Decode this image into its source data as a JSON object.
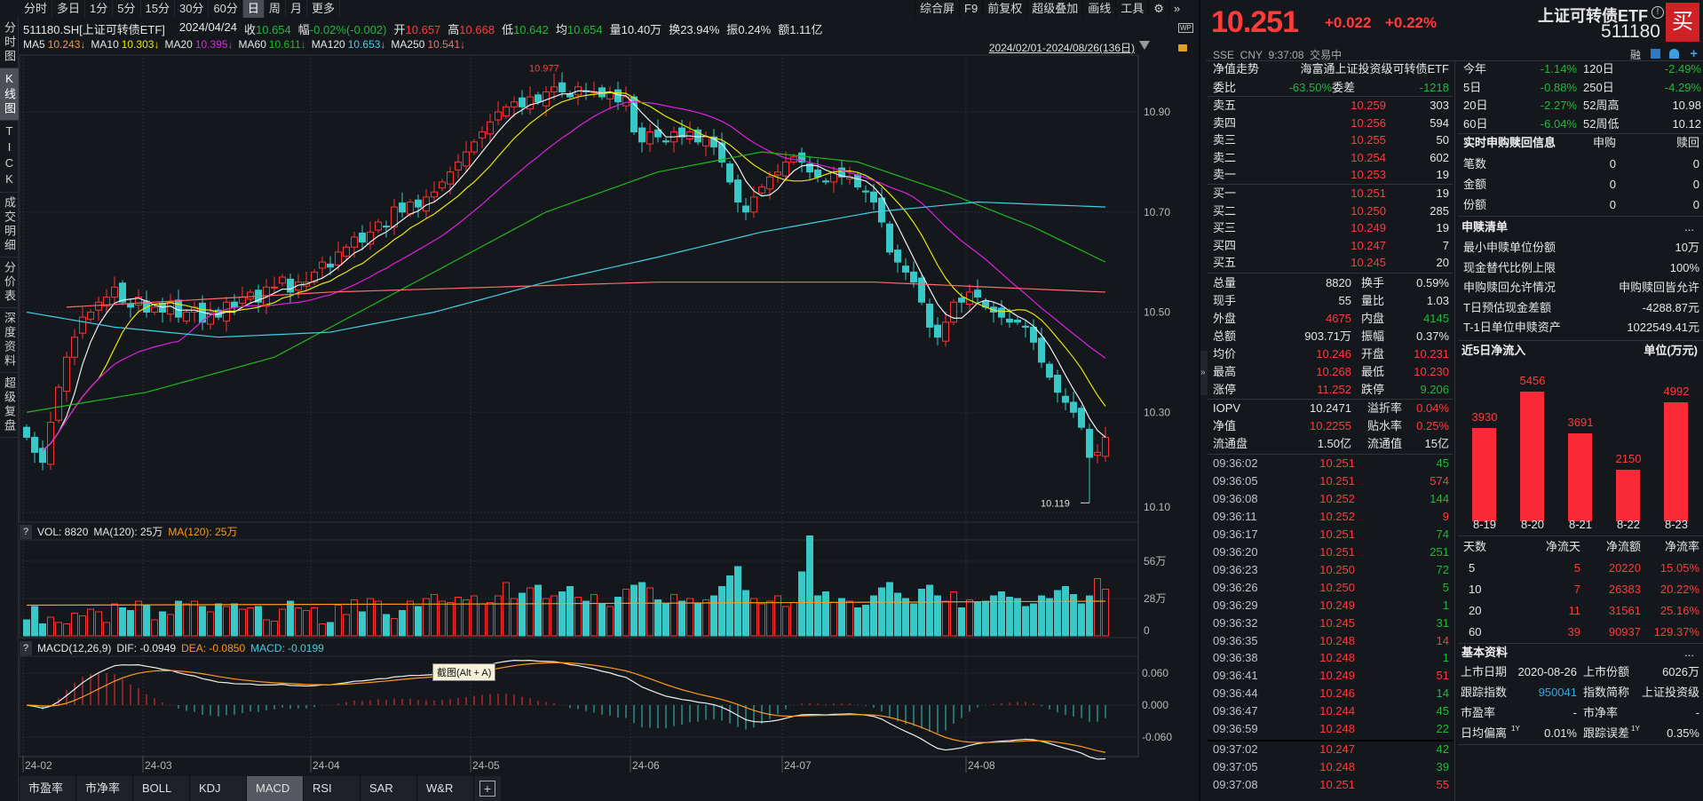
{
  "toolbar": {
    "periods": [
      "分时",
      "多日",
      "1分",
      "5分",
      "15分",
      "30分",
      "60分",
      "日",
      "周",
      "月",
      "更多"
    ],
    "active": "日",
    "tools": [
      "综合屏",
      "F9",
      "前复权",
      "超级叠加",
      "画线",
      "工具"
    ]
  },
  "side_tabs": {
    "items": [
      "分时图",
      "K线图",
      "TICK",
      "成交明细",
      "分价表",
      "深度资料",
      "超级复盘"
    ],
    "active": "K线图"
  },
  "info": {
    "code": "511180.SH[上证可转债ETF]",
    "date": "2024/04/24",
    "items": [
      {
        "label": "收",
        "value": "10.654",
        "c": "g"
      },
      {
        "label": "幅",
        "value": "-0.02%(-0.002)",
        "c": "g"
      },
      {
        "label": "开",
        "value": "10.657",
        "c": "r"
      },
      {
        "label": "高",
        "value": "10.668",
        "c": "r"
      },
      {
        "label": "低",
        "value": "10.642",
        "c": "g"
      },
      {
        "label": "均",
        "value": "10.654",
        "c": "g"
      },
      {
        "label": "量",
        "value": "10.40万",
        "c": "w"
      },
      {
        "label": "换",
        "value": "23.94%",
        "c": "w"
      },
      {
        "label": "振",
        "value": "0.24%",
        "c": "w"
      },
      {
        "label": "额",
        "value": "1.11亿",
        "c": "w"
      }
    ]
  },
  "ma_legend": [
    {
      "label": "MA5",
      "value": "10.243↓",
      "color": "#ff9a1a"
    },
    {
      "label": "MA10",
      "value": "10.303↓",
      "color": "#e8e800"
    },
    {
      "label": "MA20",
      "value": "10.395↓",
      "color": "#e020e0"
    },
    {
      "label": "MA60",
      "value": "10.611↓",
      "color": "#1fb81f"
    },
    {
      "label": "MA120",
      "value": "10.653↓",
      "color": "#40d0e8"
    },
    {
      "label": "MA250",
      "value": "10.541↓",
      "color": "#ff6a6a"
    }
  ],
  "date_range": "2024/02/01-2024/08/26(136日)",
  "wp_label": "WP",
  "vol_header": {
    "q": "?",
    "vol": "VOL: 8820",
    "ma1": "MA(120): 25万",
    "ma2": "MA(120): 25万"
  },
  "macd_header": {
    "q": "?",
    "title": "MACD(12,26,9)",
    "dif": "DIF: -0.0949",
    "dea": "DEA: -0.0850",
    "macd": "MACD: -0.0199"
  },
  "tooltip": "截图(Alt + A)",
  "bottom_tabs": {
    "items": [
      "市盈率",
      "市净率",
      "BOLL",
      "KDJ",
      "MACD",
      "RSI",
      "SAR",
      "W&R"
    ],
    "active": "MACD",
    "plus": "+"
  },
  "chart_data": [
    {
      "type": "candlestick",
      "title": "511180.SH 日K",
      "ylim": [
        10.1,
        10.98
      ],
      "price_ticks": [
        "10.90",
        "10.70",
        "10.50",
        "10.30",
        "10.10"
      ],
      "x_ticks": [
        {
          "label": "24-02",
          "index": 0
        },
        {
          "label": "24-03",
          "index": 15
        },
        {
          "label": "24-04",
          "index": 36
        },
        {
          "label": "24-05",
          "index": 56
        },
        {
          "label": "24-06",
          "index": 76
        },
        {
          "label": "24-07",
          "index": 95
        },
        {
          "label": "24-08",
          "index": 118
        }
      ],
      "high_label": {
        "text": "10.977",
        "index": 66
      },
      "low_label": {
        "text": "10.119",
        "index": 133
      },
      "close": [
        10.25,
        10.22,
        10.2,
        10.28,
        10.35,
        10.41,
        10.45,
        10.49,
        10.5,
        10.52,
        10.53,
        10.55,
        10.52,
        10.51,
        10.53,
        10.5,
        10.51,
        10.5,
        10.52,
        10.49,
        10.5,
        10.51,
        10.48,
        10.5,
        10.49,
        10.52,
        10.51,
        10.53,
        10.54,
        10.52,
        10.55,
        10.55,
        10.57,
        10.54,
        10.56,
        10.56,
        10.58,
        10.6,
        10.59,
        10.62,
        10.63,
        10.65,
        10.64,
        10.66,
        10.68,
        10.67,
        10.71,
        10.7,
        10.72,
        10.71,
        10.73,
        10.74,
        10.76,
        10.78,
        10.8,
        10.82,
        10.84,
        10.86,
        10.88,
        10.9,
        10.91,
        10.92,
        10.91,
        10.93,
        10.92,
        10.94,
        10.95,
        10.94,
        10.93,
        10.95,
        10.94,
        10.94,
        10.93,
        10.94,
        10.92,
        10.93,
        10.86,
        10.84,
        10.86,
        10.85,
        10.84,
        10.86,
        10.85,
        10.86,
        10.84,
        10.85,
        10.83,
        10.8,
        10.76,
        10.72,
        10.7,
        10.73,
        10.75,
        10.77,
        10.78,
        10.8,
        10.81,
        10.8,
        10.78,
        10.77,
        10.76,
        10.78,
        10.77,
        10.77,
        10.75,
        10.74,
        10.72,
        10.68,
        10.62,
        10.6,
        10.58,
        10.56,
        10.52,
        10.47,
        10.45,
        10.48,
        10.52,
        10.52,
        10.54,
        10.53,
        10.51,
        10.5,
        10.49,
        10.48,
        10.48,
        10.47,
        10.44,
        10.4,
        10.37,
        10.34,
        10.32,
        10.3,
        10.27,
        10.21,
        10.22,
        10.25
      ],
      "volume_wan": [
        12,
        22,
        9,
        14,
        10,
        9,
        17,
        15,
        20,
        18,
        10,
        24,
        21,
        19,
        26,
        23,
        12,
        18,
        16,
        26,
        24,
        26,
        22,
        18,
        24,
        22,
        24,
        20,
        21,
        22,
        12,
        11,
        20,
        26,
        21,
        19,
        21,
        9,
        10,
        23,
        16,
        27,
        18,
        28,
        26,
        16,
        13,
        19,
        26,
        22,
        28,
        31,
        26,
        25,
        29,
        27,
        30,
        24,
        25,
        30,
        40,
        28,
        32,
        36,
        38,
        28,
        30,
        33,
        37,
        29,
        26,
        31,
        24,
        22,
        29,
        35,
        38,
        40,
        36,
        27,
        24,
        31,
        26,
        28,
        24,
        27,
        30,
        37,
        45,
        52,
        34,
        28,
        24,
        26,
        30,
        22,
        25,
        48,
        75,
        30,
        33,
        25,
        28,
        26,
        21,
        23,
        30,
        36,
        40,
        32,
        28,
        24,
        35,
        38,
        30,
        26,
        33,
        21,
        27,
        25,
        26,
        30,
        33,
        29,
        28,
        22,
        24,
        30,
        28,
        34,
        37,
        31,
        24,
        30,
        43,
        35
      ],
      "vol_ticks": [
        "56万",
        "28万",
        "0"
      ],
      "vol_ma120_wan": 25,
      "macd_ticks": [
        "0.060",
        "0.000",
        "-0.060"
      ],
      "ma_keypoints": {
        "ma60": [
          [
            0,
            10.3
          ],
          [
            15,
            10.34
          ],
          [
            31,
            10.41
          ],
          [
            51,
            10.58
          ],
          [
            65,
            10.7
          ],
          [
            79,
            10.78
          ],
          [
            92,
            10.82
          ],
          [
            104,
            10.8
          ],
          [
            115,
            10.74
          ],
          [
            126,
            10.67
          ],
          [
            135,
            10.6
          ]
        ],
        "ma120": [
          [
            0,
            10.5
          ],
          [
            11,
            10.47
          ],
          [
            24,
            10.45
          ],
          [
            38,
            10.46
          ],
          [
            51,
            10.5
          ],
          [
            65,
            10.56
          ],
          [
            79,
            10.61
          ],
          [
            92,
            10.66
          ],
          [
            106,
            10.7
          ],
          [
            119,
            10.72
          ],
          [
            135,
            10.71
          ]
        ],
        "ma250": [
          [
            5,
            10.51
          ],
          [
            38,
            10.54
          ],
          [
            79,
            10.56
          ],
          [
            106,
            10.56
          ],
          [
            135,
            10.54
          ]
        ]
      }
    },
    {
      "type": "bar",
      "title": "近5日净流入",
      "unit": "单位(万元)",
      "categories": [
        "8-19",
        "8-20",
        "8-21",
        "8-22",
        "8-23"
      ],
      "values": [
        3930,
        5456,
        3691,
        2150,
        4992
      ]
    }
  ],
  "quote": {
    "price": "10.251",
    "change": "+0.022",
    "pct": "+0.22%",
    "name": "上证可转债ETF",
    "code": "511180",
    "buy": "买",
    "status": "SSE  CNY  9:37:08  交易中",
    "rong": "融"
  },
  "order_book": {
    "header": {
      "label": "净值走势",
      "value": "海富通上证投资级可转债ETF"
    },
    "weibi": {
      "l1": "委比",
      "v1": "-63.50%",
      "l2": "委差",
      "v2": "-1218"
    },
    "asks": [
      {
        "label": "卖五",
        "price": "10.259",
        "vol": "303"
      },
      {
        "label": "卖四",
        "price": "10.256",
        "vol": "594"
      },
      {
        "label": "卖三",
        "price": "10.255",
        "vol": "50"
      },
      {
        "label": "卖二",
        "price": "10.254",
        "vol": "602"
      },
      {
        "label": "卖一",
        "price": "10.253",
        "vol": "19"
      }
    ],
    "bids": [
      {
        "label": "买一",
        "price": "10.251",
        "vol": "19"
      },
      {
        "label": "买二",
        "price": "10.250",
        "vol": "285"
      },
      {
        "label": "买三",
        "price": "10.249",
        "vol": "19"
      },
      {
        "label": "买四",
        "price": "10.247",
        "vol": "7"
      },
      {
        "label": "买五",
        "price": "10.245",
        "vol": "20"
      }
    ]
  },
  "stats": [
    {
      "l1": "总量",
      "v1": "8820",
      "c1": "w",
      "l2": "换手",
      "v2": "0.59%",
      "c2": "w"
    },
    {
      "l1": "现手",
      "v1": "55",
      "c1": "w",
      "l2": "量比",
      "v2": "1.03",
      "c2": "w"
    },
    {
      "l1": "外盘",
      "v1": "4675",
      "c1": "r",
      "l2": "内盘",
      "v2": "4145",
      "c2": "g"
    },
    {
      "l1": "总额",
      "v1": "903.71万",
      "c1": "w",
      "l2": "振幅",
      "v2": "0.37%",
      "c2": "w"
    },
    {
      "l1": "均价",
      "v1": "10.246",
      "c1": "r",
      "l2": "开盘",
      "v2": "10.231",
      "c2": "r"
    },
    {
      "l1": "最高",
      "v1": "10.268",
      "c1": "r",
      "l2": "最低",
      "v2": "10.230",
      "c2": "r"
    },
    {
      "l1": "涨停",
      "v1": "11.252",
      "c1": "r",
      "l2": "跌停",
      "v2": "9.206",
      "c2": "g"
    }
  ],
  "etf_stats": [
    {
      "l1": "IOPV",
      "v1": "10.2471",
      "c1": "w",
      "l2": "溢折率",
      "v2": "0.04%",
      "c2": "r"
    },
    {
      "l1": "净值",
      "v1": "10.2255",
      "c1": "r",
      "l2": "贴水率",
      "v2": "0.25%",
      "c2": "r"
    },
    {
      "l1": "流通盘",
      "v1": "1.50亿",
      "c1": "w",
      "l2": "流通值",
      "v2": "15亿",
      "c2": "w"
    }
  ],
  "trades": [
    {
      "time": "09:36:02",
      "price": "10.251",
      "dir": "down",
      "vol": "45",
      "vc": "g"
    },
    {
      "time": "09:36:05",
      "price": "10.251",
      "dir": "",
      "vol": "574",
      "vc": "r"
    },
    {
      "time": "09:36:08",
      "price": "10.252",
      "dir": "up",
      "vol": "144",
      "vc": "g"
    },
    {
      "time": "09:36:11",
      "price": "10.252",
      "dir": "",
      "vol": "9",
      "vc": "r"
    },
    {
      "time": "09:36:17",
      "price": "10.251",
      "dir": "down",
      "vol": "74",
      "vc": "g"
    },
    {
      "time": "09:36:20",
      "price": "10.251",
      "dir": "",
      "vol": "251",
      "vc": "g"
    },
    {
      "time": "09:36:23",
      "price": "10.250",
      "dir": "down",
      "vol": "72",
      "vc": "g"
    },
    {
      "time": "09:36:26",
      "price": "10.250",
      "dir": "",
      "vol": "5",
      "vc": "g"
    },
    {
      "time": "09:36:29",
      "price": "10.249",
      "dir": "down",
      "vol": "1",
      "vc": "g"
    },
    {
      "time": "09:36:32",
      "price": "10.245",
      "dir": "down",
      "vol": "31",
      "vc": "g"
    },
    {
      "time": "09:36:35",
      "price": "10.248",
      "dir": "up",
      "vol": "14",
      "vc": "r"
    },
    {
      "time": "09:36:38",
      "price": "10.248",
      "dir": "",
      "vol": "1",
      "vc": "g"
    },
    {
      "time": "09:36:41",
      "price": "10.249",
      "dir": "up",
      "vol": "51",
      "vc": "r"
    },
    {
      "time": "09:36:44",
      "price": "10.246",
      "dir": "down",
      "vol": "14",
      "vc": "g"
    },
    {
      "time": "09:36:47",
      "price": "10.244",
      "dir": "down",
      "vol": "45",
      "vc": "g"
    },
    {
      "time": "09:36:59",
      "price": "10.248",
      "dir": "up",
      "vol": "22",
      "vc": "g"
    },
    {
      "time": "09:37:02",
      "price": "10.247",
      "dir": "down",
      "vol": "42",
      "vc": "g"
    },
    {
      "time": "09:37:05",
      "price": "10.248",
      "dir": "up",
      "vol": "39",
      "vc": "g"
    },
    {
      "time": "09:37:08",
      "price": "10.251",
      "dir": "up",
      "vol": "55",
      "vc": "r"
    }
  ],
  "performance": [
    {
      "l1": "今年",
      "v1": "-1.14%",
      "c1": "g",
      "l2": "120日",
      "v2": "-2.49%",
      "c2": "g"
    },
    {
      "l1": "5日",
      "v1": "-0.88%",
      "c1": "g",
      "l2": "250日",
      "v2": "-4.29%",
      "c2": "g"
    },
    {
      "l1": "20日",
      "v1": "-2.27%",
      "c1": "g",
      "l2": "52周高",
      "v2": "10.98",
      "c2": "w"
    },
    {
      "l1": "60日",
      "v1": "-6.04%",
      "c1": "g",
      "l2": "52周低",
      "v2": "10.12",
      "c2": "w"
    }
  ],
  "subscription": {
    "title": "实时申购赎回信息",
    "col1": "申购",
    "col2": "赎回",
    "rows": [
      {
        "label": "笔数",
        "v1": "0",
        "v2": "0"
      },
      {
        "label": "金额",
        "v1": "0",
        "v2": "0"
      },
      {
        "label": "份额",
        "v1": "0",
        "v2": "0"
      }
    ]
  },
  "creation_list": {
    "title": "申赎清单",
    "more": "...",
    "rows": [
      {
        "label": "最小申赎单位份额",
        "value": "10万"
      },
      {
        "label": "现金替代比例上限",
        "value": "100%"
      },
      {
        "label": "申购赎回允许情况",
        "value": "申购赎回皆允许"
      },
      {
        "label": "T日预估现金差额",
        "value": "-4288.87元"
      },
      {
        "label": "T-1日单位申赎资产",
        "value": "1022549.41元"
      }
    ]
  },
  "net_flow_table": {
    "headers": [
      "天数",
      "净流天",
      "净流额",
      "净流率"
    ],
    "rows": [
      [
        "5",
        "5",
        "20220",
        "15.05%"
      ],
      [
        "10",
        "7",
        "26383",
        "20.22%"
      ],
      [
        "20",
        "11",
        "31561",
        "25.16%"
      ],
      [
        "60",
        "39",
        "90937",
        "129.37%"
      ]
    ]
  },
  "basic_info": {
    "title": "基本资料",
    "more": "...",
    "rows": [
      {
        "l1": "上市日期",
        "v1": "2020-08-26",
        "c1": "w",
        "l2": "上市份额",
        "v2": "6026万",
        "c2": "w"
      },
      {
        "l1": "跟踪指数",
        "v1": "950041",
        "c1": "b",
        "l2": "指数简称",
        "v2": "上证投资级",
        "c2": "w"
      },
      {
        "l1": "市盈率",
        "v1": "-",
        "c1": "w",
        "l2": "市净率",
        "v2": "-",
        "c2": "w"
      },
      {
        "l1": "日均偏离",
        "s1": "1Y",
        "v1": "0.01%",
        "c1": "w",
        "l2": "跟踪误差",
        "s2": "1Y",
        "v2": "0.35%",
        "c2": "w"
      }
    ]
  },
  "colors": {
    "up": "#ff3232",
    "down": "#38c8c8",
    "bg": "#14171c",
    "grid": "#3a3d44",
    "accent_red": "#fb2a36"
  }
}
